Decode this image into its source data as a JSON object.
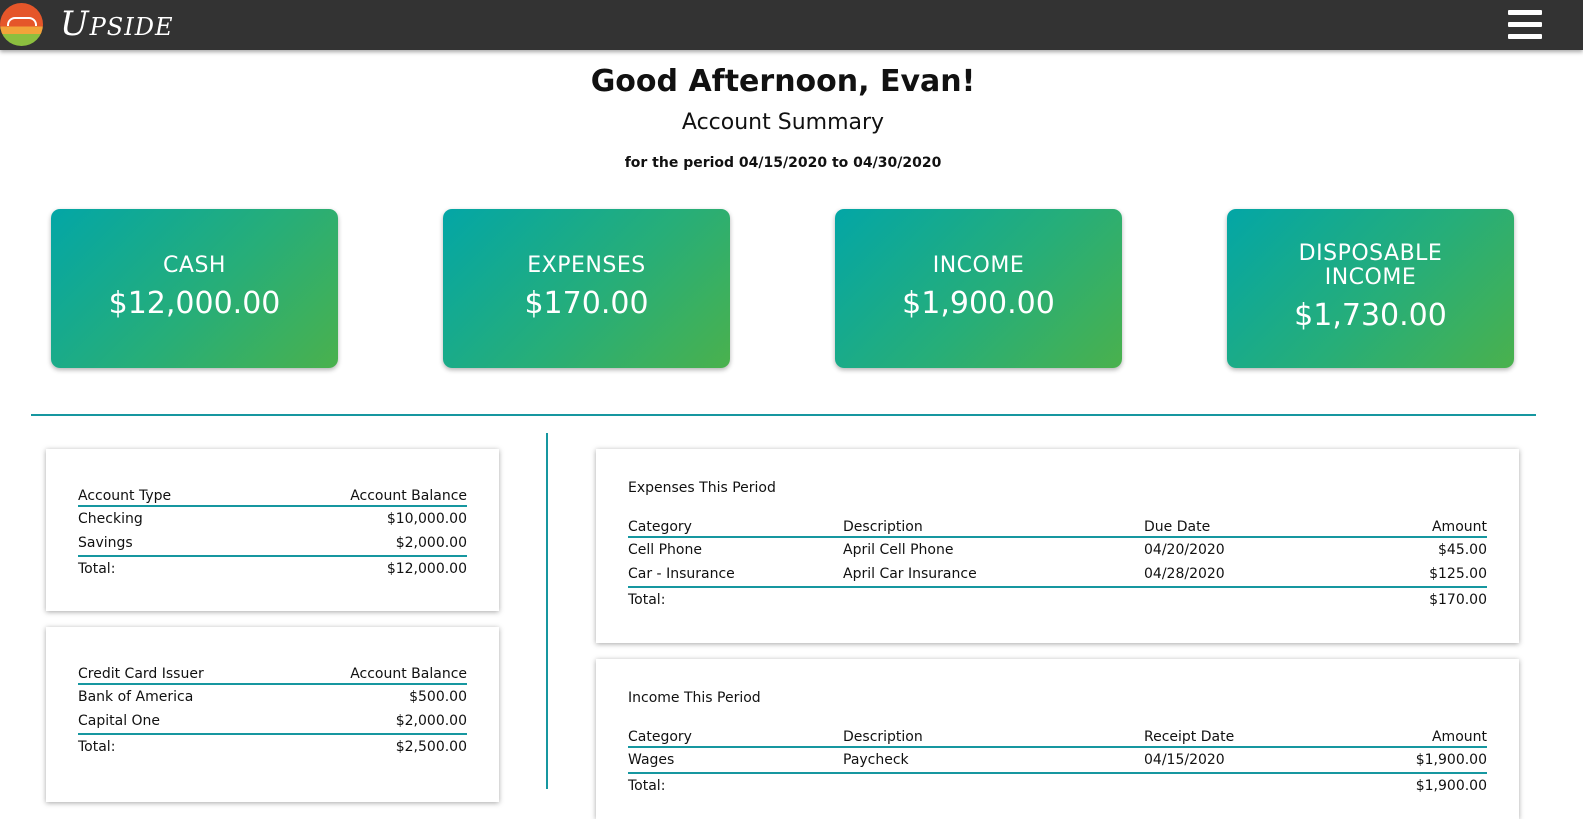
{
  "app": {
    "brand": "Upside",
    "menu_icon": "hamburger-menu-icon",
    "logo_icon": "upside-logo-icon"
  },
  "header": {
    "greeting": "Good Afternoon, Evan!",
    "title": "Account Summary",
    "period": "for the period 04/15/2020 to 04/30/2020"
  },
  "cards": [
    {
      "label": "CASH",
      "value": "$12,000.00"
    },
    {
      "label": "EXPENSES",
      "value": "$170.00"
    },
    {
      "label": "INCOME",
      "value": "$1,900.00"
    },
    {
      "label": "DISPOSABLE INCOME",
      "value": "$1,730.00"
    }
  ],
  "accounts": {
    "headers": [
      "Account Type",
      "Account Balance"
    ],
    "rows": [
      [
        "Checking",
        "$10,000.00"
      ],
      [
        "Savings",
        "$2,000.00"
      ]
    ],
    "total": [
      "Total:",
      "$12,000.00"
    ]
  },
  "credit_cards": {
    "headers": [
      "Credit Card Issuer",
      "Account Balance"
    ],
    "rows": [
      [
        "Bank of America",
        "$500.00"
      ],
      [
        "Capital One",
        "$2,000.00"
      ]
    ],
    "total": [
      "Total:",
      "$2,500.00"
    ]
  },
  "expenses": {
    "title": "Expenses This Period",
    "headers": [
      "Category",
      "Description",
      "Due Date",
      "Amount"
    ],
    "rows": [
      [
        "Cell Phone",
        "April Cell Phone",
        "04/20/2020",
        "$45.00"
      ],
      [
        "Car - Insurance",
        "April Car Insurance",
        "04/28/2020",
        "$125.00"
      ]
    ],
    "total": [
      "Total:",
      "$170.00"
    ]
  },
  "income": {
    "title": "Income This Period",
    "headers": [
      "Category",
      "Description",
      "Receipt Date",
      "Amount"
    ],
    "rows": [
      [
        "Wages",
        "Paycheck",
        "04/15/2020",
        "$1,900.00"
      ]
    ],
    "total": [
      "Total:",
      "$1,900.00"
    ]
  },
  "colors": {
    "topbar": "#333333",
    "accent": "#1697a0",
    "card_gradient_start": "#03a6a6",
    "card_gradient_end": "#4ab14d"
  }
}
